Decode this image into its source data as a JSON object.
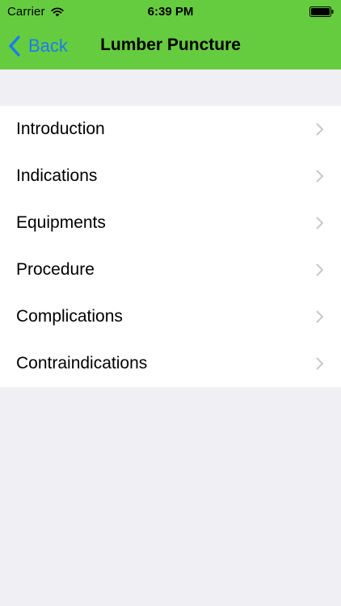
{
  "status_bar": {
    "carrier": "Carrier",
    "time": "6:39 PM"
  },
  "nav_bar": {
    "back_label": "Back",
    "title": "Lumber Puncture"
  },
  "menu": {
    "items": [
      {
        "label": "Introduction",
        "icon": "chevron-right-icon"
      },
      {
        "label": "Indications",
        "icon": "chevron-right-icon"
      },
      {
        "label": "Equipments",
        "icon": "chevron-right-icon"
      },
      {
        "label": "Procedure",
        "icon": "chevron-right-icon"
      },
      {
        "label": "Complications",
        "icon": "chevron-right-icon"
      },
      {
        "label": "Contraindications",
        "icon": "chevron-right-icon"
      }
    ]
  },
  "colors": {
    "header_bg": "#66cc3f",
    "accent": "#1a7cf0",
    "page_bg": "#efeff4",
    "list_bg": "#ffffff"
  }
}
